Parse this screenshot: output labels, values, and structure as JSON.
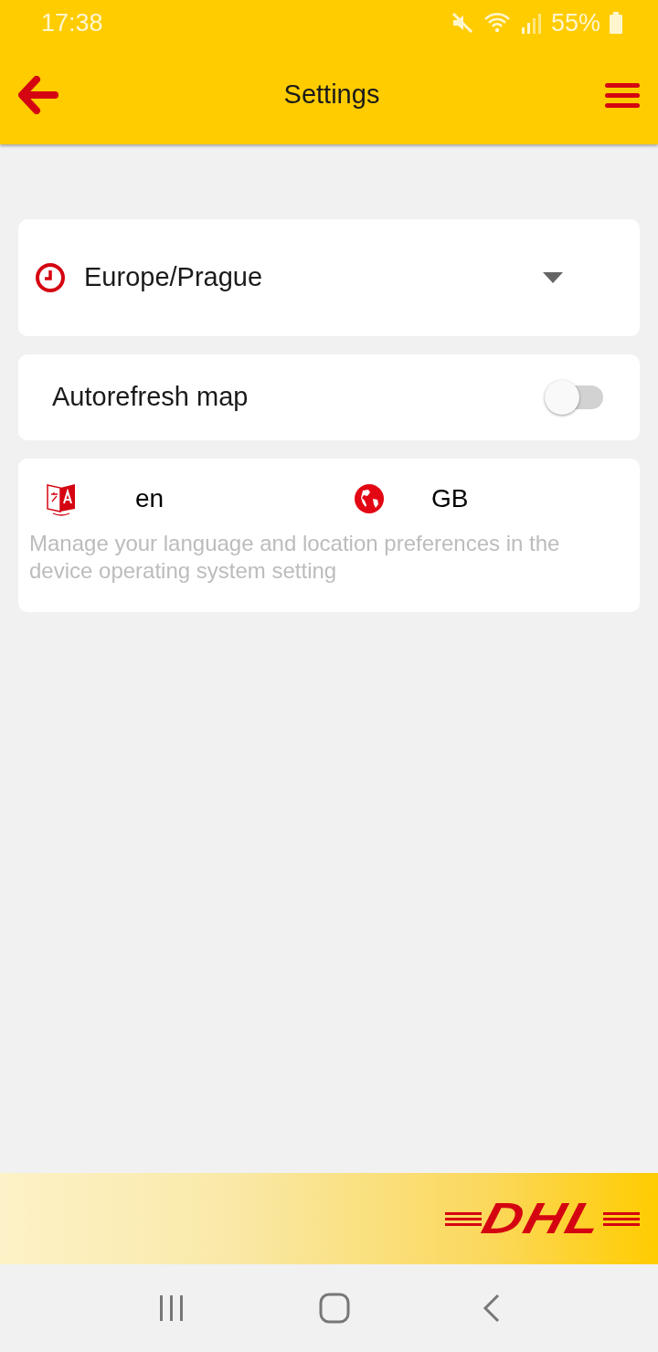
{
  "status_bar": {
    "time": "17:38",
    "battery": "55%"
  },
  "app_bar": {
    "title": "Settings"
  },
  "timezone": {
    "value": "Europe/Prague"
  },
  "autorefresh": {
    "label": "Autorefresh map",
    "on": false
  },
  "locale": {
    "language": "en",
    "region": "GB",
    "note": "Manage your language and location preferences in the device operating system setting"
  },
  "footer": {
    "logo": "DHL"
  }
}
